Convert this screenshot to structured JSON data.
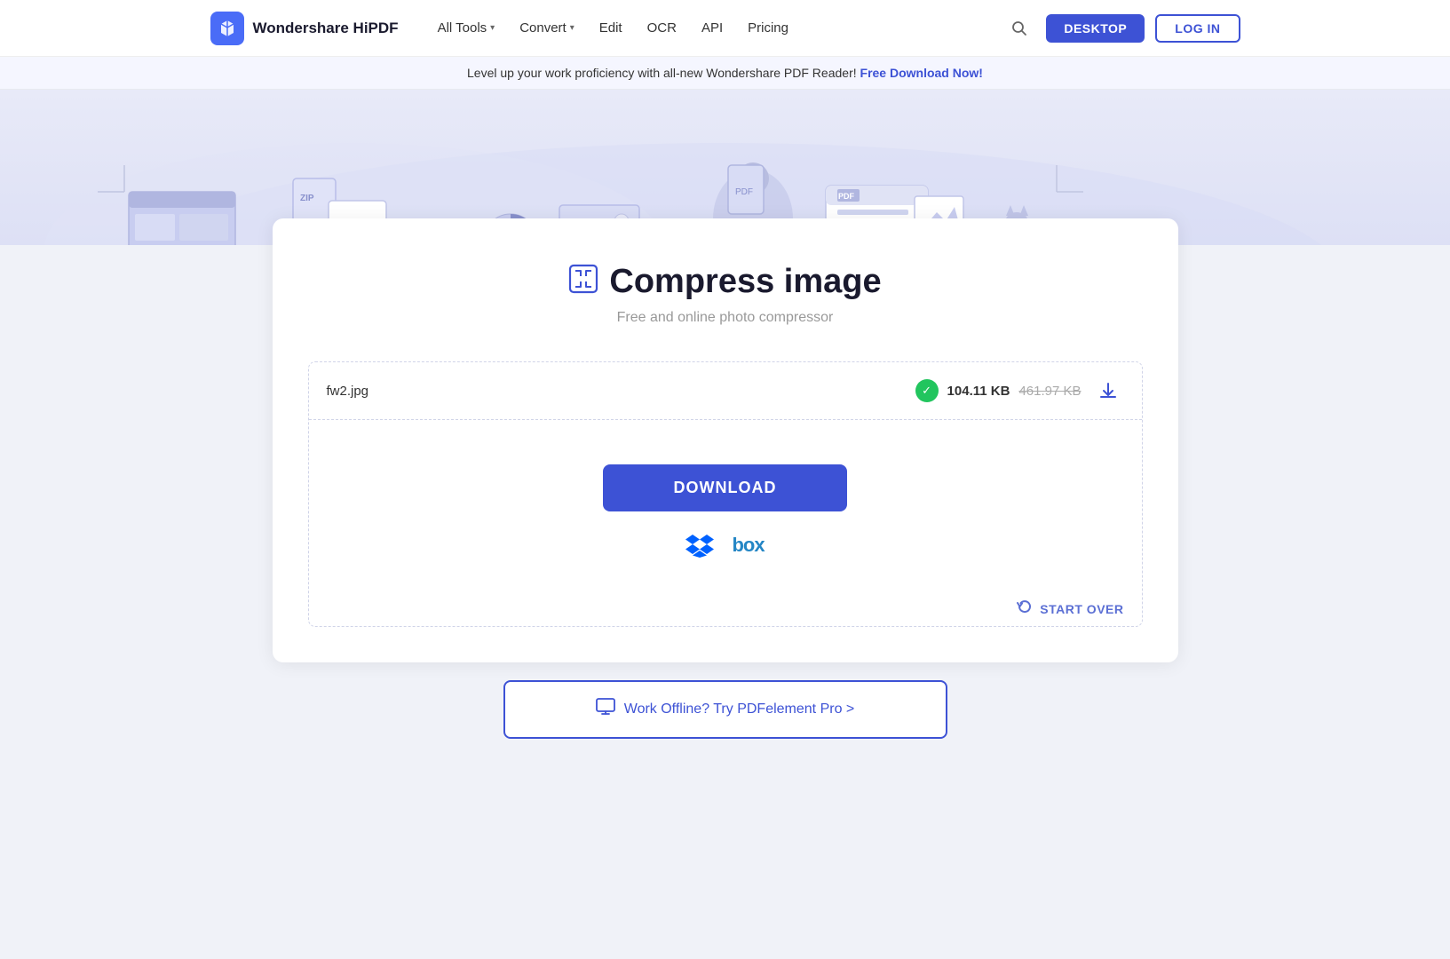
{
  "navbar": {
    "logo_text": "Wondershare HiPDF",
    "nav_items": [
      {
        "label": "All Tools",
        "has_arrow": true
      },
      {
        "label": "Convert",
        "has_arrow": true
      },
      {
        "label": "Edit",
        "has_arrow": false
      },
      {
        "label": "OCR",
        "has_arrow": false
      },
      {
        "label": "API",
        "has_arrow": false
      },
      {
        "label": "Pricing",
        "has_arrow": false
      }
    ],
    "btn_desktop": "DESKTOP",
    "btn_login": "LOG IN"
  },
  "banner": {
    "text": "Level up your work proficiency with all-new Wondershare PDF Reader!",
    "link_text": "Free Download Now!"
  },
  "page": {
    "title": "Compress image",
    "subtitle": "Free and online photo compressor"
  },
  "file": {
    "name": "fw2.jpg",
    "size_new": "104.11 KB",
    "size_old": "461.97 KB"
  },
  "actions": {
    "download_label": "DOWNLOAD",
    "start_over_label": "START OVER",
    "offline_label": "Work Offline? Try PDFelement Pro >"
  },
  "colors": {
    "accent": "#3d52d5",
    "green": "#22c55e"
  }
}
